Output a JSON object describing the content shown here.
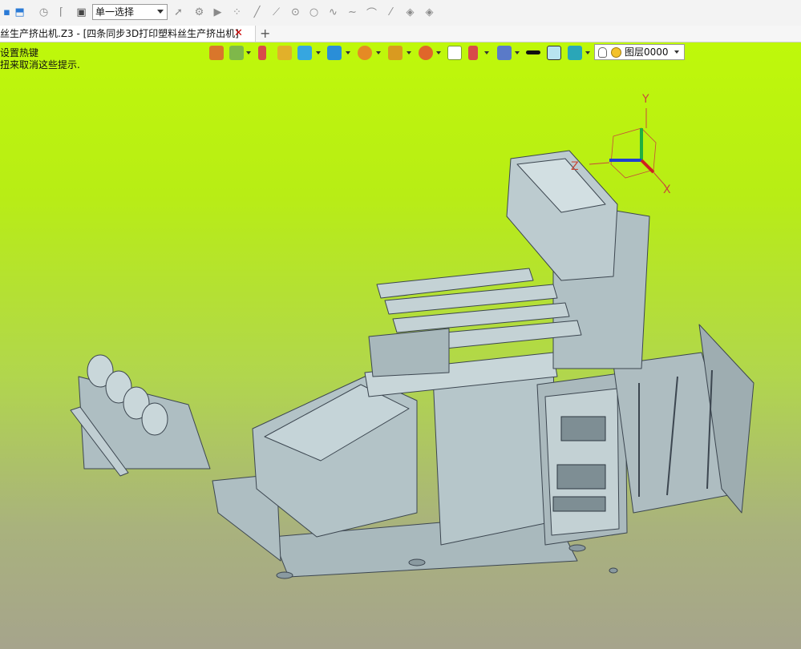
{
  "toolbar": {
    "selection_mode": "单一选择",
    "icons": [
      "save-icon",
      "import-icon",
      "rotate-icon",
      "filter-icon",
      "stop-icon",
      "pointer-icon",
      "gear-icon",
      "play-icon",
      "points-icon",
      "line-icon",
      "line-icon-2",
      "circle-center-icon",
      "circle-icon",
      "spline-icon",
      "arc-icon",
      "line-icon-3",
      "layer-icon",
      "layer-icon-2"
    ]
  },
  "tabs": {
    "document_tab": "丝生产挤出机.Z3 - [四条同步3D打印塑料丝生产挤出机]",
    "close_glyph": "✕",
    "new_tab_glyph": "+"
  },
  "hints": {
    "line1": "设置热键",
    "line2": "扭来取消这些提示."
  },
  "view_toolbar": {
    "layer_name": "图层0000",
    "colors": {
      "color_swatch": "#b8e4ef",
      "line_swatch": "#111111"
    }
  },
  "triad": {
    "x_label": "X",
    "y_label": "Y",
    "z_label": "Z"
  },
  "viewport": {
    "gradient_top": "#bff80a",
    "gradient_bottom": "#a6a48c",
    "model_color": "#b8c8cc"
  }
}
